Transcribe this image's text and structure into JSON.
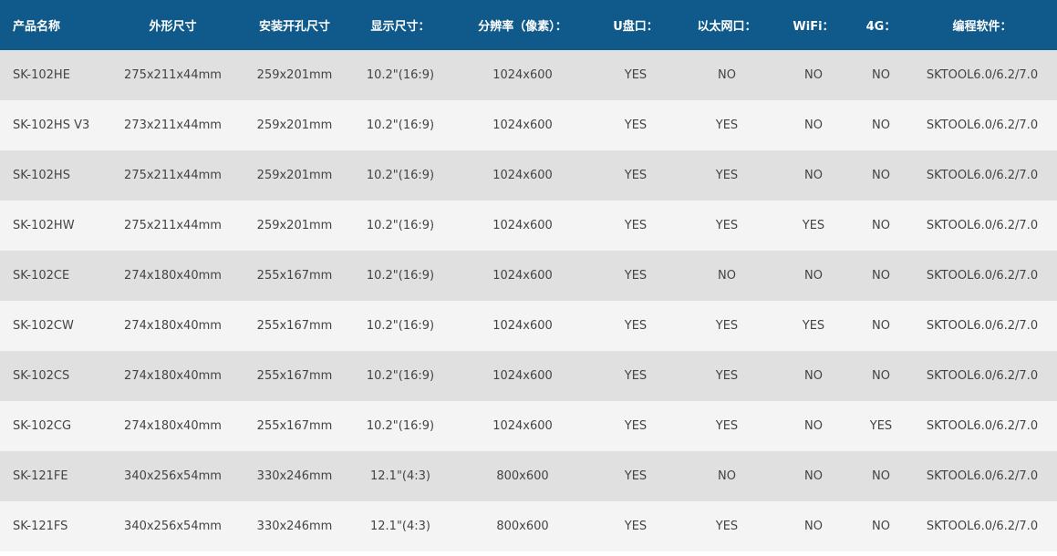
{
  "header_bg": "#0f5a8a",
  "columns": [
    "产品名称",
    "外形尺寸",
    "安装开孔尺寸",
    "显示尺寸：",
    "分辨率（像素）：",
    "U盘口：",
    "以太网口：",
    "WiFi：",
    "4G：",
    "编程软件："
  ],
  "rows": [
    [
      "SK-102HE",
      "275x211x44mm",
      "259x201mm",
      "10.2\"(16:9)",
      "1024x600",
      "YES",
      "NO",
      "NO",
      "NO",
      "SKTOOL6.0/6.2/7.0"
    ],
    [
      "SK-102HS V3",
      "273x211x44mm",
      "259x201mm",
      "10.2\"(16:9)",
      "1024x600",
      "YES",
      "YES",
      "NO",
      "NO",
      "SKTOOL6.0/6.2/7.0"
    ],
    [
      "SK-102HS",
      "275x211x44mm",
      "259x201mm",
      "10.2\"(16:9)",
      "1024x600",
      "YES",
      "YES",
      "NO",
      "NO",
      "SKTOOL6.0/6.2/7.0"
    ],
    [
      "SK-102HW",
      "275x211x44mm",
      "259x201mm",
      "10.2\"(16:9)",
      "1024x600",
      "YES",
      "YES",
      "YES",
      "NO",
      "SKTOOL6.0/6.2/7.0"
    ],
    [
      "SK-102CE",
      "274x180x40mm",
      "255x167mm",
      "10.2\"(16:9)",
      "1024x600",
      "YES",
      "NO",
      "NO",
      "NO",
      "SKTOOL6.0/6.2/7.0"
    ],
    [
      "SK-102CW",
      "274x180x40mm",
      "255x167mm",
      "10.2\"(16:9)",
      "1024x600",
      "YES",
      "YES",
      "YES",
      "NO",
      "SKTOOL6.0/6.2/7.0"
    ],
    [
      "SK-102CS",
      "274x180x40mm",
      "255x167mm",
      "10.2\"(16:9)",
      "1024x600",
      "YES",
      "YES",
      "NO",
      "NO",
      "SKTOOL6.0/6.2/7.0"
    ],
    [
      "SK-102CG",
      "274x180x40mm",
      "255x167mm",
      "10.2\"(16:9)",
      "1024x600",
      "YES",
      "YES",
      "NO",
      "YES",
      "SKTOOL6.0/6.2/7.0"
    ],
    [
      "SK-121FE",
      "340x256x54mm",
      "330x246mm",
      "12.1\"(4:3)",
      "800x600",
      "YES",
      "NO",
      "NO",
      "NO",
      "SKTOOL6.0/6.2/7.0"
    ],
    [
      "SK-121FS",
      "340x256x54mm",
      "330x246mm",
      "12.1\"(4:3)",
      "800x600",
      "YES",
      "YES",
      "NO",
      "NO",
      "SKTOOL6.0/6.2/7.0"
    ]
  ]
}
